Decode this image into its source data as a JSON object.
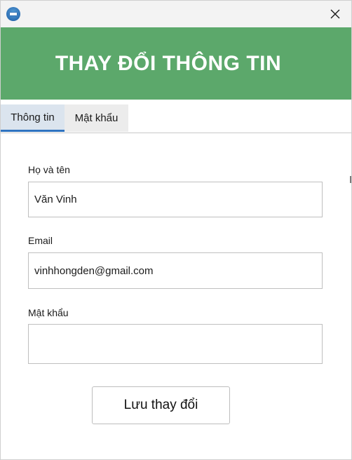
{
  "window": {
    "icon": "app-logo-icon",
    "close_icon": "close-icon"
  },
  "header": {
    "title": "THAY ĐỔI THÔNG TIN",
    "background": "#5ca86b"
  },
  "tabs": [
    {
      "label": "Thông tin",
      "active": true
    },
    {
      "label": "Mật khẩu",
      "active": false
    }
  ],
  "form": {
    "fullname": {
      "label": "Họ và tên",
      "value": "Văn Vinh"
    },
    "email": {
      "label": "Email",
      "value": "vinhhongden@gmail.com"
    },
    "password": {
      "label": "Mật khẩu",
      "value": ""
    }
  },
  "save_button": {
    "label": "Lưu thay đổi"
  }
}
